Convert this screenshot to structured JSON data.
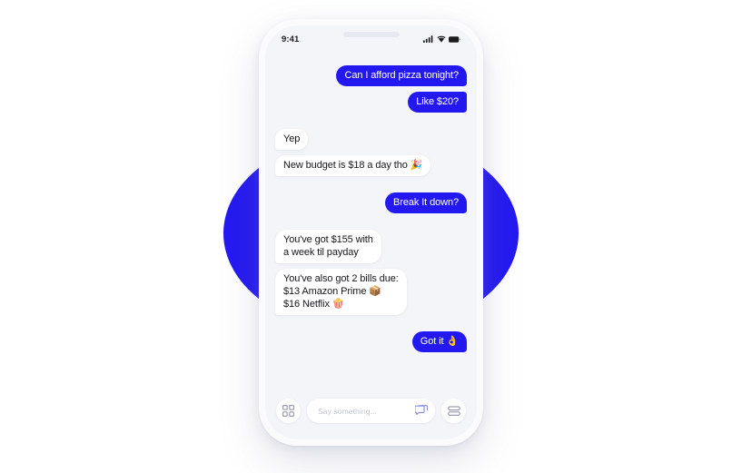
{
  "colors": {
    "accent_blue": "#2318F0",
    "screen_bg": "#F4F5F9",
    "phone_body": "#FBFBFD",
    "incoming_bubble": "#FFFFFF",
    "chat_icon": "#8D8FE8",
    "placeholder_text": "#C3C6D4",
    "page_bg": "#FFFFFF"
  },
  "status_bar": {
    "time": "9:41",
    "icons": [
      "signal-icon",
      "wifi-icon",
      "battery-icon"
    ]
  },
  "conversation": {
    "messages": [
      {
        "id": "m1",
        "direction": "out",
        "text": "Can I afford pizza tonight?"
      },
      {
        "id": "m2",
        "direction": "out",
        "text": "Like $20?"
      },
      {
        "id": "m3",
        "direction": "in",
        "text": "Yep"
      },
      {
        "id": "m4",
        "direction": "in",
        "text": "New budget is $18 a day tho 🎉"
      },
      {
        "id": "m5",
        "direction": "out",
        "text": "Break It down?"
      },
      {
        "id": "m6",
        "direction": "in",
        "text": "You've got $155 with\na week til payday"
      },
      {
        "id": "m7",
        "direction": "in",
        "text": "You've also got 2 bills due:\n$13 Amazon Prime 📦\n$16 Netflix 🍿"
      },
      {
        "id": "m8",
        "direction": "out",
        "text": "Got it 👌"
      }
    ]
  },
  "composer": {
    "grid_button": "grid-icon",
    "placeholder": "Say something...",
    "value": "",
    "chat_button": "chat-bubble-icon",
    "menu_button": "stacked-lines-icon"
  }
}
